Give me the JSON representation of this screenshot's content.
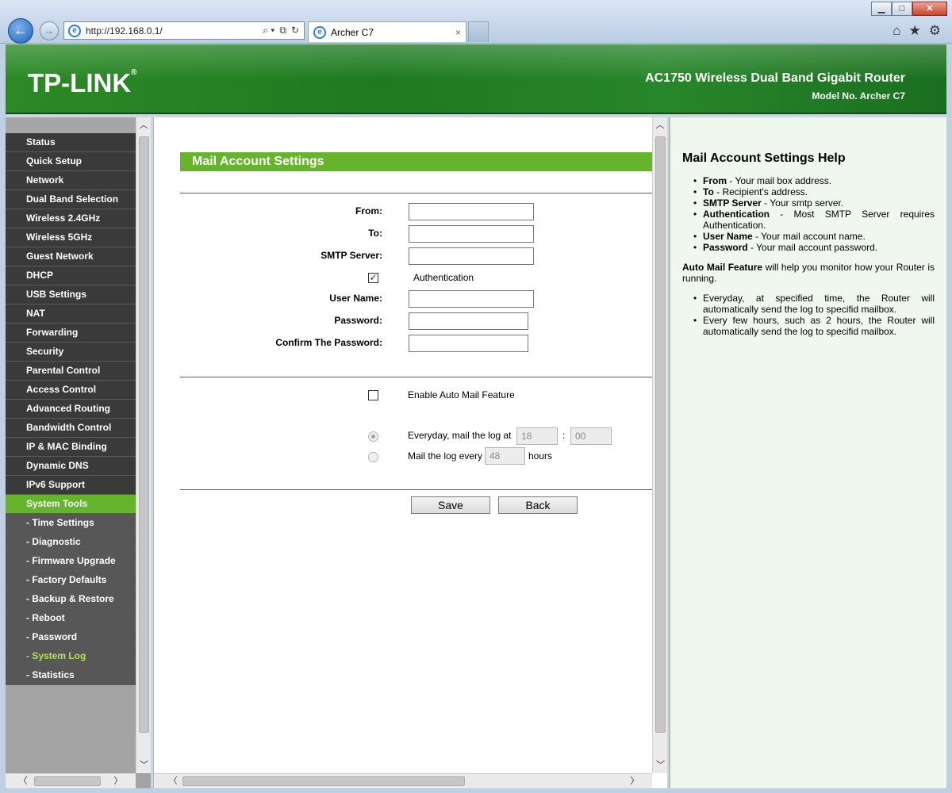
{
  "browser": {
    "url": "http://192.168.0.1/",
    "tab_title": "Archer C7",
    "back_glyph": "←",
    "forward_glyph": "→",
    "search_glyph": "⌕ ▾",
    "compat_glyph": "⧉",
    "refresh_glyph": "↻",
    "close_tab_glyph": "×",
    "home_glyph": "⌂",
    "favorites_glyph": "★",
    "settings_glyph": "⚙",
    "minimize_glyph": "▁",
    "maximize_glyph": "□",
    "close_glyph": "✕"
  },
  "header": {
    "logo": "TP-LINK",
    "logo_mark": "®",
    "product": "AC1750 Wireless Dual Band Gigabit Router",
    "model": "Model No. Archer C7"
  },
  "menu": {
    "items": [
      {
        "label": "Status"
      },
      {
        "label": "Quick Setup"
      },
      {
        "label": "Network"
      },
      {
        "label": "Dual Band Selection"
      },
      {
        "label": "Wireless 2.4GHz"
      },
      {
        "label": "Wireless 5GHz"
      },
      {
        "label": "Guest Network"
      },
      {
        "label": "DHCP"
      },
      {
        "label": "USB Settings"
      },
      {
        "label": "NAT"
      },
      {
        "label": "Forwarding"
      },
      {
        "label": "Security"
      },
      {
        "label": "Parental Control"
      },
      {
        "label": "Access Control"
      },
      {
        "label": "Advanced Routing"
      },
      {
        "label": "Bandwidth Control"
      },
      {
        "label": "IP & MAC Binding"
      },
      {
        "label": "Dynamic DNS"
      },
      {
        "label": "IPv6 Support"
      },
      {
        "label": "System Tools"
      },
      {
        "label": "- Time Settings"
      },
      {
        "label": "- Diagnostic"
      },
      {
        "label": "- Firmware Upgrade"
      },
      {
        "label": "- Factory Defaults"
      },
      {
        "label": "- Backup & Restore"
      },
      {
        "label": "- Reboot"
      },
      {
        "label": "- Password"
      },
      {
        "label": "- System Log"
      },
      {
        "label": "- Statistics"
      }
    ]
  },
  "scroll": {
    "up": "︿",
    "down": "﹀",
    "left": "〈",
    "right": "〉"
  },
  "form": {
    "title": "Mail Account Settings",
    "from_label": "From:",
    "from_value": "",
    "to_label": "To:",
    "to_value": "",
    "smtp_label": "SMTP Server:",
    "smtp_value": "",
    "auth_label": "Authentication",
    "auth_checked": true,
    "auth_check_glyph": "✓",
    "username_label": "User Name:",
    "username_value": "",
    "password_label": "Password:",
    "password_value": "",
    "confirm_label": "Confirm The Password:",
    "confirm_value": "",
    "auto_mail_label": "Enable Auto Mail Feature",
    "auto_mail_checked": false,
    "everyday_label": "Everyday, mail the log at",
    "everyday_hour": "18",
    "time_sep": ":",
    "everyday_minute": "00",
    "every_label": "Mail the log every",
    "every_hours": "48",
    "hours_label": "hours",
    "save_label": "Save",
    "back_label": "Back"
  },
  "help": {
    "title": "Mail Account Settings Help",
    "items": [
      {
        "term": "From",
        "desc": " - Your mail box address."
      },
      {
        "term": "To",
        "desc": " - Recipient's address."
      },
      {
        "term": "SMTP Server",
        "desc": " - Your smtp server."
      },
      {
        "term": "Authentication",
        "desc": " - Most SMTP Server requires Authentication."
      },
      {
        "term": "User Name",
        "desc": " - Your mail account name."
      },
      {
        "term": "Password",
        "desc": " - Your mail account password."
      }
    ],
    "auto_term": "Auto Mail Feature",
    "auto_desc": " will help you monitor how your Router is running.",
    "auto_items": [
      "Everyday, at specified time, the Router will automatically send the log to specifid mailbox.",
      "Every few hours, such as 2 hours, the Router will automatically send the log to specifid mailbox."
    ]
  }
}
